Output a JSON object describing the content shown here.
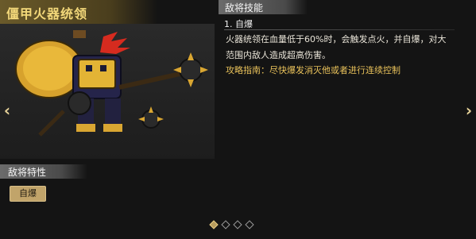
{
  "general": {
    "title": "僵甲火器统领"
  },
  "skills": {
    "header": "敌将技能",
    "items": [
      {
        "name": "1. 自爆",
        "description": "火器统领在血量低于60%时，会触发点火，并自爆，对大范围内敌人造成超高伤害。"
      }
    ],
    "guide": "攻略指南：尽快爆发消灭他或者进行连续控制"
  },
  "traits": {
    "header": "敌将特性",
    "items": [
      "自爆"
    ]
  },
  "pager": {
    "total": 4,
    "current": 1
  },
  "colors": {
    "accent": "#f3d87a",
    "guide": "#e8c15a",
    "badge": "#c1a46a"
  }
}
